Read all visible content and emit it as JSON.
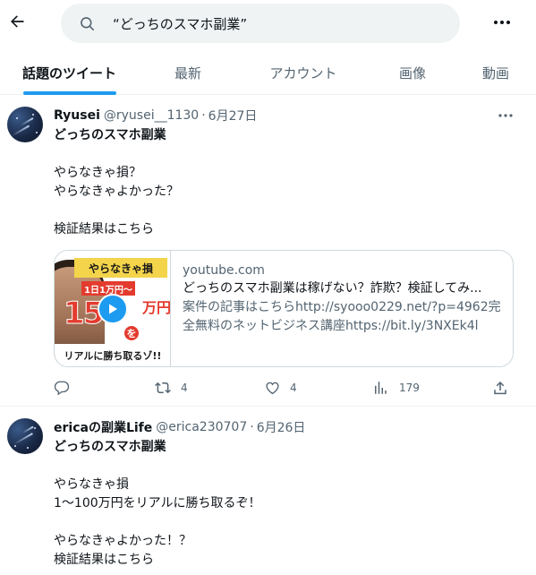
{
  "search": {
    "query": "“どっちのスマホ副業”"
  },
  "tabs": [
    {
      "label": "話題のツイート",
      "active": true
    },
    {
      "label": "最新",
      "active": false
    },
    {
      "label": "アカウント",
      "active": false
    },
    {
      "label": "画像",
      "active": false
    },
    {
      "label": "動画",
      "active": false
    }
  ],
  "tweets": [
    {
      "name": "Ryusei",
      "handle": "@ryusei__1130",
      "dot": "·",
      "date": "6月27日",
      "lines": [
        "どっちのスマホ副業",
        "やらなきゃ損？",
        "やらなきゃよかった？",
        "検証結果はこちら"
      ],
      "card": {
        "thumb_banner": "やらなきゃ損",
        "thumb_tag": "1日1万円〜",
        "thumb_number": "150",
        "thumb_unit": "万円",
        "thumb_wo": "を",
        "thumb_bottom": "リアルに勝ち取るゾ!!",
        "domain": "youtube.com",
        "title": "どっちのスマホ副業は稼げない？詐欺？検証してみ...",
        "desc_line1": "案件の記事はこちらhttp://syooo0229.net/?p=4962完",
        "desc_line2": "全無料のネットビジネス講座https://bit.ly/3NXEk4l"
      },
      "stats": {
        "replies": "",
        "retweets": "4",
        "likes": "4",
        "views": "179"
      }
    },
    {
      "name": "ericaの副業Life",
      "handle": "@erica230707",
      "dot": "·",
      "date": "6月26日",
      "lines": [
        "どっちのスマホ副業",
        "やらなきゃ損",
        "1〜100万円をリアルに勝ち取るぞ！",
        "やらなきゃよかった！？",
        "検証結果はこちら"
      ]
    }
  ],
  "colors": {
    "accent": "#1d9bf0",
    "muted": "#536471",
    "text": "#0f1419",
    "border": "#eff3f4"
  }
}
